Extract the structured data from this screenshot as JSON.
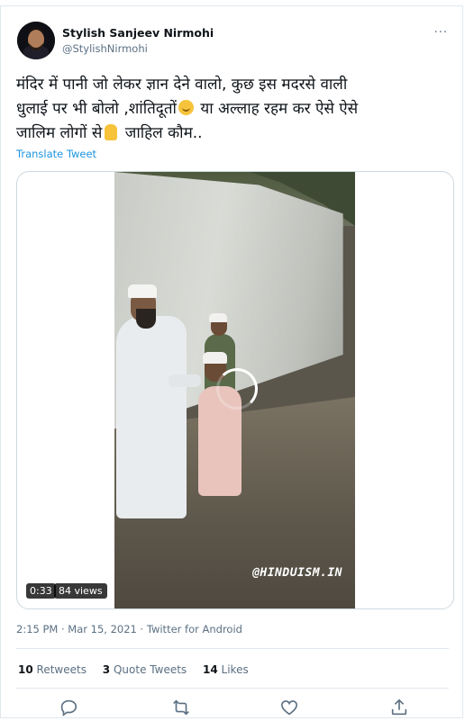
{
  "tweet": {
    "display_name": "Stylish Sanjeev Nirmohi",
    "handle": "@StylishNirmohi",
    "more_label": "···",
    "text_line1": "मंदिर में पानी जो लेकर ज्ञान देने वालो, कुछ इस मदरसे वाली",
    "text_line2a": "धुलाई पर भी बोलो ,शांतिदूतों",
    "text_line2b": " या अल्लाह रहम कर ऐसे ऐसे",
    "text_line3a": "जालिम लोगों से",
    "text_line3b": " जाहिल कौम..",
    "translate_label": "Translate Tweet",
    "timestamp": "2:15 PM · Mar 15, 2021 · Twitter for Android"
  },
  "media": {
    "duration": "0:33",
    "views": "84 views",
    "watermark": "@HINDUISM.IN"
  },
  "stats": {
    "retweets_count": "10",
    "retweets_label": "Retweets",
    "quote_count": "3",
    "quote_label": "Quote Tweets",
    "likes_count": "14",
    "likes_label": "Likes"
  },
  "icons": [
    "reply-icon",
    "retweet-icon",
    "like-icon",
    "share-icon"
  ],
  "colors": {
    "link": "#1b95e0",
    "secondary": "#5b7083",
    "border": "#e1e8ed"
  }
}
